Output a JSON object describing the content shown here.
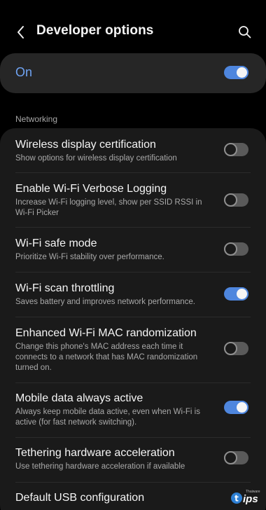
{
  "header": {
    "title": "Developer options",
    "back_icon": "back-arrow-icon",
    "search_icon": "search-icon"
  },
  "master": {
    "label": "On",
    "enabled": true
  },
  "section": {
    "label": "Networking"
  },
  "items": [
    {
      "title": "Wireless display certification",
      "subtitle": "Show options for wireless display certification",
      "enabled": false
    },
    {
      "title": "Enable Wi-Fi Verbose Logging",
      "subtitle": "Increase Wi-Fi logging level, show per SSID RSSI in Wi-Fi Picker",
      "enabled": false
    },
    {
      "title": "Wi-Fi safe mode",
      "subtitle": "Prioritize Wi-Fi stability over performance.",
      "enabled": false
    },
    {
      "title": "Wi-Fi scan throttling",
      "subtitle": "Saves battery and improves network performance.",
      "enabled": true
    },
    {
      "title": "Enhanced Wi-Fi MAC randomization",
      "subtitle": "Change this phone's MAC address each time it connects to a network that has MAC randomization turned on.",
      "enabled": false
    },
    {
      "title": "Mobile data always active",
      "subtitle": "Always keep mobile data active, even when Wi-Fi is active (for fast network switching).",
      "enabled": true
    },
    {
      "title": "Tethering hardware acceleration",
      "subtitle": "Use tethering hardware acceleration if available",
      "enabled": false
    },
    {
      "title": "Default USB configuration",
      "subtitle": "",
      "enabled": false
    }
  ],
  "watermark": {
    "text": "ips",
    "brand": "Thaiware",
    "accent": "#2d7fd3"
  },
  "colors": {
    "accent": "#4e86de",
    "master_label": "#6fa3f3",
    "background": "#000000",
    "card": "#1a1a1a"
  }
}
